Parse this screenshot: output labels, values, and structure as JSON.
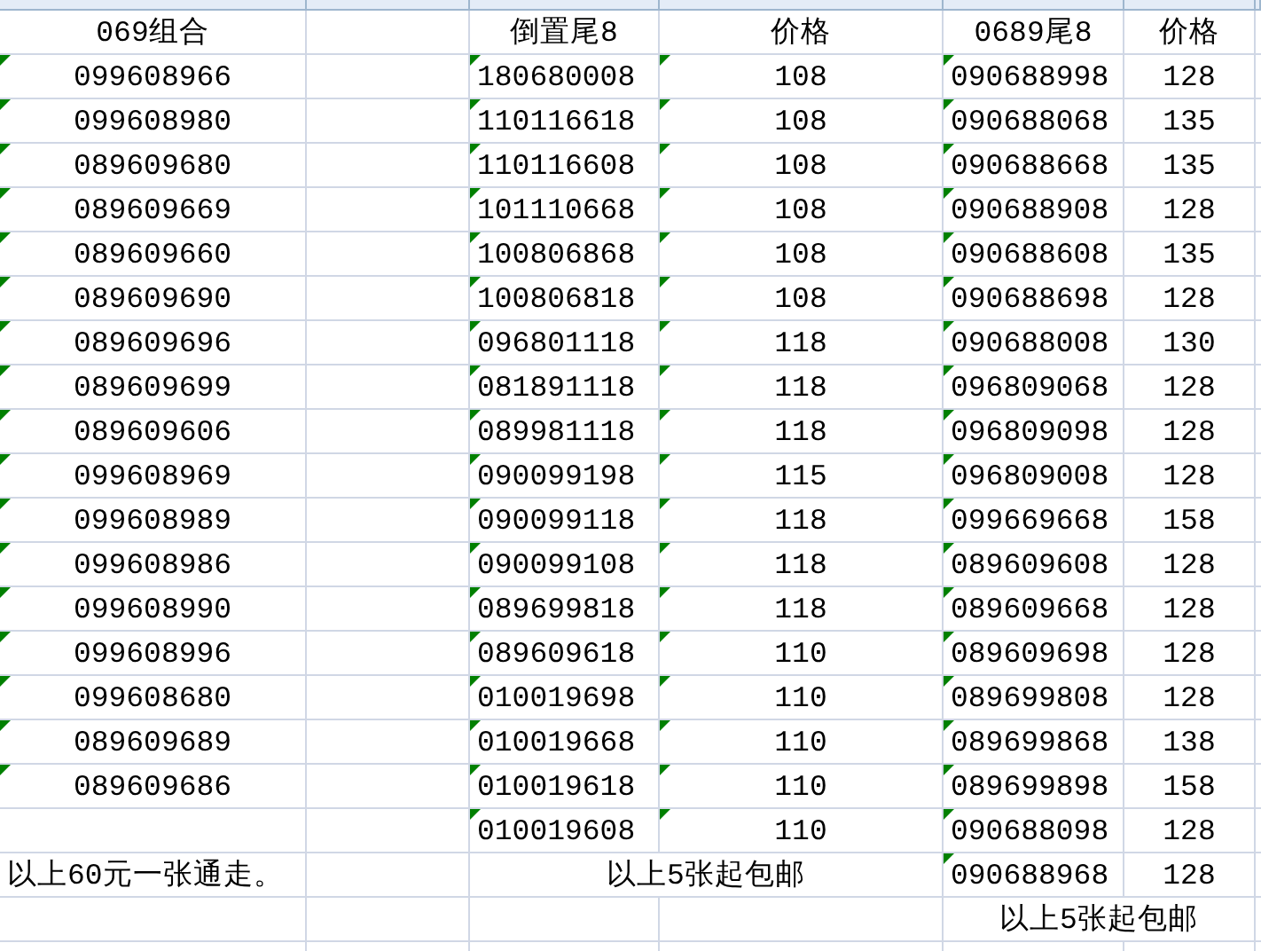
{
  "rows": [
    {
      "kind": "header",
      "cells": [
        {
          "text": "069组合",
          "flag": false
        },
        {},
        {
          "text": "倒置尾8",
          "flag": false
        },
        {
          "text": "价格",
          "flag": false
        },
        {
          "text": "0689尾8",
          "flag": false
        },
        {
          "text": "价格",
          "flag": false
        }
      ]
    },
    {
      "kind": "data",
      "cells": [
        {
          "text": "099608966",
          "flag": true
        },
        {},
        {
          "text": "180680008",
          "flag": true
        },
        {
          "text": "108",
          "flag": true
        },
        {
          "text": "090688998",
          "flag": true
        },
        {
          "text": "128",
          "flag": false
        }
      ]
    },
    {
      "kind": "data",
      "cells": [
        {
          "text": "099608980",
          "flag": true
        },
        {},
        {
          "text": "110116618",
          "flag": true
        },
        {
          "text": "108",
          "flag": true
        },
        {
          "text": "090688068",
          "flag": true
        },
        {
          "text": "135",
          "flag": false
        }
      ]
    },
    {
      "kind": "data",
      "cells": [
        {
          "text": "089609680",
          "flag": true
        },
        {},
        {
          "text": "110116608",
          "flag": true
        },
        {
          "text": "108",
          "flag": true
        },
        {
          "text": "090688668",
          "flag": true
        },
        {
          "text": "135",
          "flag": false
        }
      ]
    },
    {
      "kind": "data",
      "cells": [
        {
          "text": "089609669",
          "flag": true
        },
        {},
        {
          "text": "101110668",
          "flag": true
        },
        {
          "text": "108",
          "flag": true
        },
        {
          "text": "090688908",
          "flag": true
        },
        {
          "text": "128",
          "flag": false
        }
      ]
    },
    {
      "kind": "data",
      "cells": [
        {
          "text": "089609660",
          "flag": true
        },
        {},
        {
          "text": "100806868",
          "flag": true
        },
        {
          "text": "108",
          "flag": true
        },
        {
          "text": "090688608",
          "flag": true
        },
        {
          "text": "135",
          "flag": false
        }
      ]
    },
    {
      "kind": "data",
      "cells": [
        {
          "text": "089609690",
          "flag": true
        },
        {},
        {
          "text": "100806818",
          "flag": true
        },
        {
          "text": "108",
          "flag": true
        },
        {
          "text": "090688698",
          "flag": true
        },
        {
          "text": "128",
          "flag": false
        }
      ]
    },
    {
      "kind": "data",
      "cells": [
        {
          "text": "089609696",
          "flag": true
        },
        {},
        {
          "text": "096801118",
          "flag": true
        },
        {
          "text": "118",
          "flag": true
        },
        {
          "text": "090688008",
          "flag": true
        },
        {
          "text": "130",
          "flag": false
        }
      ]
    },
    {
      "kind": "data",
      "cells": [
        {
          "text": "089609699",
          "flag": true
        },
        {},
        {
          "text": "081891118",
          "flag": true
        },
        {
          "text": "118",
          "flag": true
        },
        {
          "text": "096809068",
          "flag": true
        },
        {
          "text": "128",
          "flag": false
        }
      ]
    },
    {
      "kind": "data",
      "cells": [
        {
          "text": "089609606",
          "flag": true
        },
        {},
        {
          "text": "089981118",
          "flag": true
        },
        {
          "text": "118",
          "flag": true
        },
        {
          "text": "096809098",
          "flag": true
        },
        {
          "text": "128",
          "flag": false
        }
      ]
    },
    {
      "kind": "data",
      "cells": [
        {
          "text": "099608969",
          "flag": true
        },
        {},
        {
          "text": "090099198",
          "flag": true
        },
        {
          "text": "115",
          "flag": true
        },
        {
          "text": "096809008",
          "flag": true
        },
        {
          "text": "128",
          "flag": false
        }
      ]
    },
    {
      "kind": "data",
      "cells": [
        {
          "text": "099608989",
          "flag": true
        },
        {},
        {
          "text": "090099118",
          "flag": true
        },
        {
          "text": "118",
          "flag": true
        },
        {
          "text": "099669668",
          "flag": true
        },
        {
          "text": "158",
          "flag": false
        }
      ]
    },
    {
      "kind": "data",
      "cells": [
        {
          "text": "099608986",
          "flag": true
        },
        {},
        {
          "text": "090099108",
          "flag": true
        },
        {
          "text": "118",
          "flag": true
        },
        {
          "text": "089609608",
          "flag": true
        },
        {
          "text": "128",
          "flag": false
        }
      ]
    },
    {
      "kind": "data",
      "cells": [
        {
          "text": "099608990",
          "flag": true
        },
        {},
        {
          "text": "089699818",
          "flag": true
        },
        {
          "text": "118",
          "flag": true
        },
        {
          "text": "089609668",
          "flag": true
        },
        {
          "text": "128",
          "flag": false
        }
      ]
    },
    {
      "kind": "data",
      "cells": [
        {
          "text": "099608996",
          "flag": true
        },
        {},
        {
          "text": "089609618",
          "flag": true
        },
        {
          "text": "110",
          "flag": true
        },
        {
          "text": "089609698",
          "flag": true
        },
        {
          "text": "128",
          "flag": false
        }
      ]
    },
    {
      "kind": "data",
      "cells": [
        {
          "text": "099608680",
          "flag": true
        },
        {},
        {
          "text": "010019698",
          "flag": true
        },
        {
          "text": "110",
          "flag": true
        },
        {
          "text": "089699808",
          "flag": true
        },
        {
          "text": "128",
          "flag": false
        }
      ]
    },
    {
      "kind": "data",
      "cells": [
        {
          "text": "089609689",
          "flag": true
        },
        {},
        {
          "text": "010019668",
          "flag": true
        },
        {
          "text": "110",
          "flag": true
        },
        {
          "text": "089699868",
          "flag": true
        },
        {
          "text": "138",
          "flag": false
        }
      ]
    },
    {
      "kind": "data",
      "cells": [
        {
          "text": "089609686",
          "flag": true
        },
        {},
        {
          "text": "010019618",
          "flag": true
        },
        {
          "text": "110",
          "flag": true
        },
        {
          "text": "089699898",
          "flag": true
        },
        {
          "text": "158",
          "flag": false
        }
      ]
    },
    {
      "kind": "data",
      "cells": [
        {},
        {},
        {
          "text": "010019608",
          "flag": true
        },
        {
          "text": "110",
          "flag": true
        },
        {
          "text": "090688098",
          "flag": true
        },
        {
          "text": "128",
          "flag": false
        }
      ]
    },
    {
      "kind": "footer",
      "cells": [
        {
          "text": "以上60元一张通走。",
          "flag": false
        },
        {},
        {
          "text": "以上5张起包邮",
          "flag": false,
          "merged": true
        },
        {
          "text": "090688968",
          "flag": true
        },
        {
          "text": "128",
          "flag": false
        }
      ]
    },
    {
      "kind": "footer",
      "cells": [
        {},
        {},
        {},
        {},
        {
          "text": "以上5张起包邮",
          "flag": false,
          "merged": true
        }
      ]
    }
  ]
}
